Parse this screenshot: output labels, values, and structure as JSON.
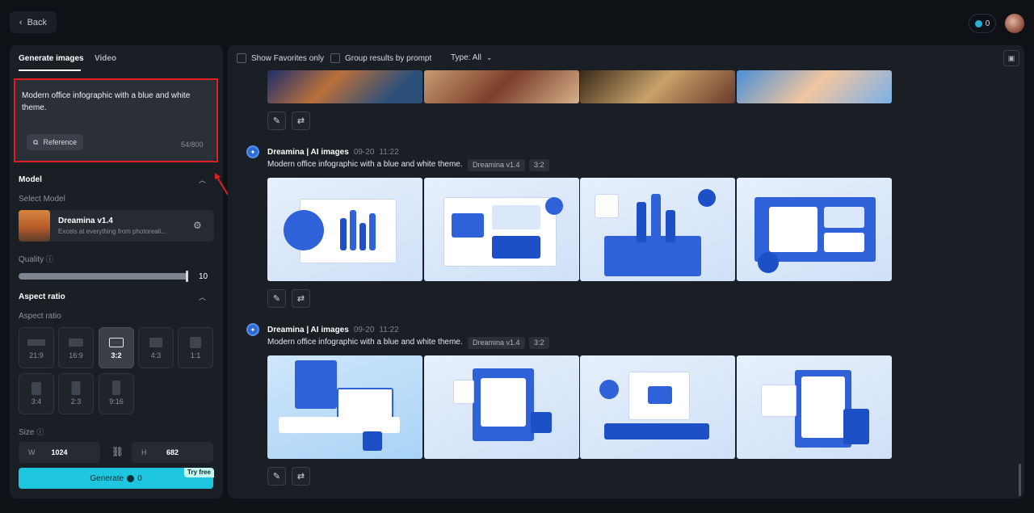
{
  "topbar": {
    "back_label": "Back",
    "credits": "0"
  },
  "left": {
    "tabs": [
      "Generate images",
      "Video"
    ],
    "prompt": {
      "text": "Modern office infographic with a blue and white theme.",
      "reference_label": "Reference",
      "count": "54/800"
    },
    "model": {
      "section_title": "Model",
      "select_label": "Select Model",
      "name": "Dreamina v1.4",
      "description": "Excels at everything from photoreali..."
    },
    "quality": {
      "label": "Quality",
      "value": "10",
      "level_fraction": 1.0
    },
    "aspect": {
      "section_title": "Aspect ratio",
      "sub_label": "Aspect ratio",
      "options": [
        "21:9",
        "16:9",
        "3:2",
        "4:3",
        "1:1",
        "3:4",
        "2:3",
        "9:16"
      ],
      "selected": "3:2"
    },
    "size": {
      "label": "Size",
      "w_letter": "W",
      "w_value": "1024",
      "h_letter": "H",
      "h_value": "682"
    },
    "generate": {
      "label": "Generate",
      "cost": "0",
      "badge": "Try free"
    }
  },
  "right": {
    "filters": {
      "favorites_label": "Show Favorites only",
      "group_label": "Group results by prompt",
      "type_label": "Type: All"
    },
    "generations": [
      {
        "name": "Dreamina | AI images",
        "date": "09-20",
        "time": "11:22",
        "prompt": "Modern office infographic with a blue and white theme.",
        "model_tag": "Dreamina v1.4",
        "ratio_tag": "3:2"
      },
      {
        "name": "Dreamina | AI images",
        "date": "09-20",
        "time": "11:22",
        "prompt": "Modern office infographic with a blue and white theme.",
        "model_tag": "Dreamina v1.4",
        "ratio_tag": "3:2"
      }
    ]
  },
  "colors": {
    "accent": "#1fc6df",
    "highlight": "#e02020",
    "panel": "#1a1e25",
    "background": "#0e1116"
  }
}
